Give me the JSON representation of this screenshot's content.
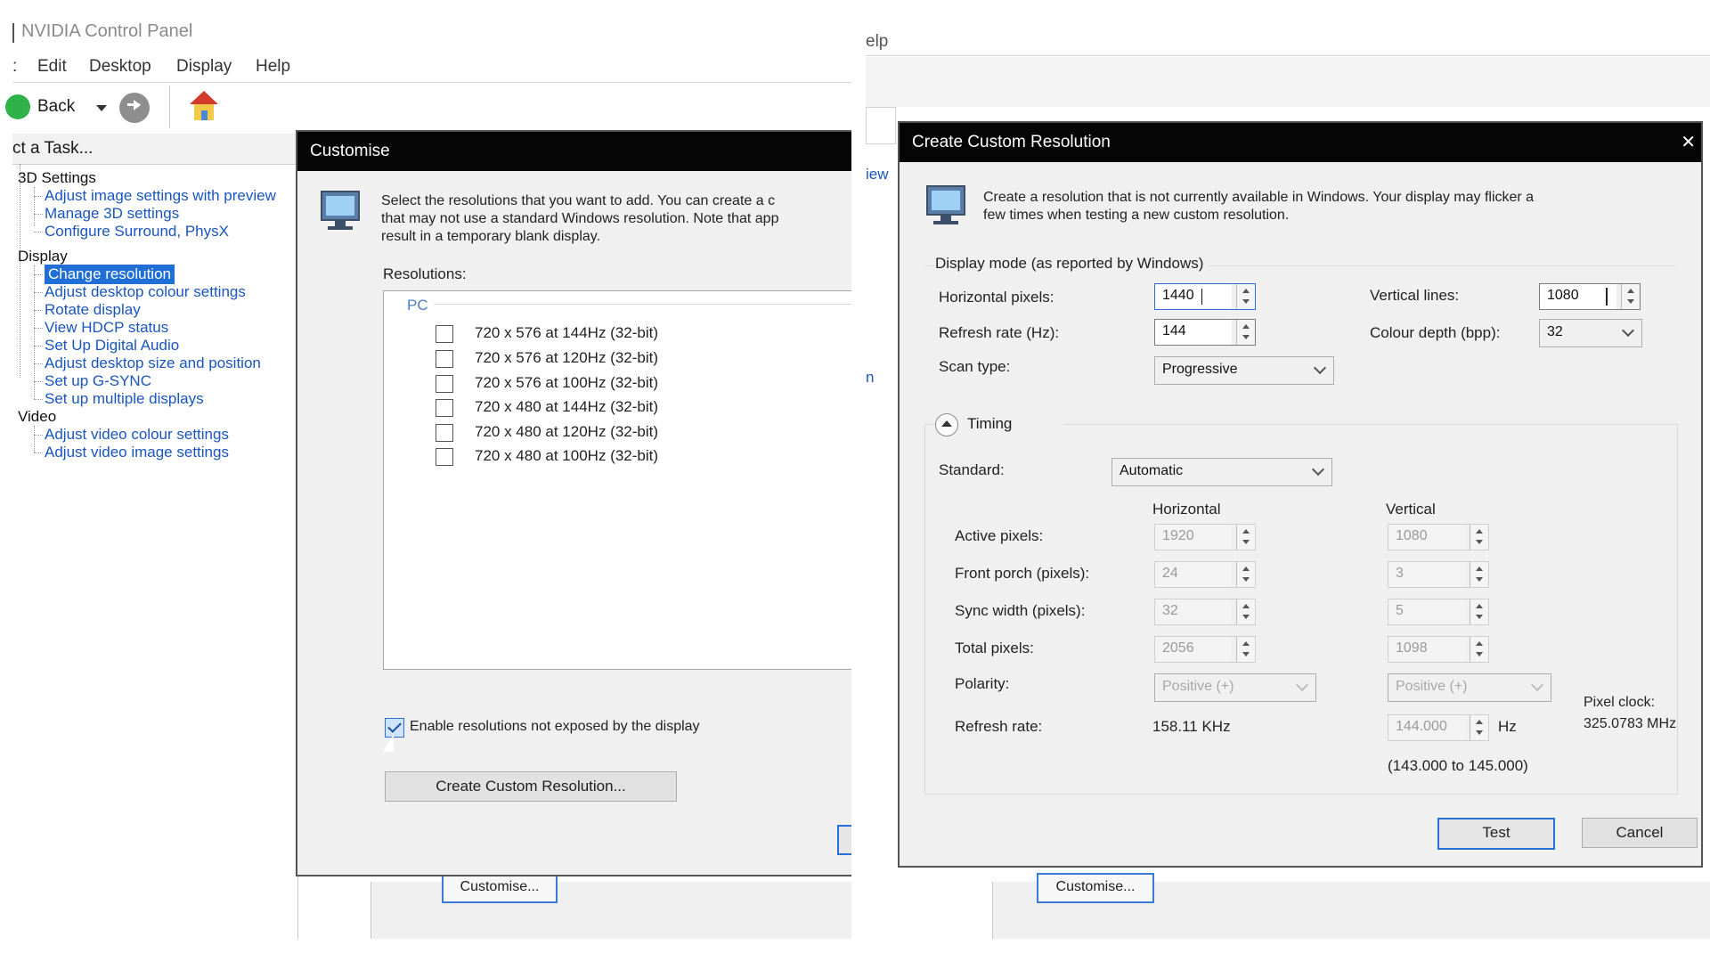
{
  "left": {
    "window_title": "NVIDIA Control Panel",
    "menu": [
      "Edit",
      "Desktop",
      "Display",
      "Help"
    ],
    "menu_fragment": ":",
    "toolbar": {
      "back_label": "Back"
    },
    "task_header": "ct a Task...",
    "tree": {
      "categories": [
        {
          "label": "3D Settings",
          "items": [
            "Adjust image settings with preview",
            "Manage 3D settings",
            "Configure Surround, PhysX"
          ]
        },
        {
          "label": "Display",
          "items": [
            "Change resolution",
            "Adjust desktop colour settings",
            "Rotate display",
            "View HDCP status",
            "Set Up Digital Audio",
            "Adjust desktop size and position",
            "Set up G-SYNC",
            "Set up multiple displays"
          ]
        },
        {
          "label": "Video",
          "items": [
            "Adjust video colour settings",
            "Adjust video image settings"
          ]
        }
      ],
      "selected_item": "Change resolution"
    },
    "background_customise_button": "Customise...",
    "customise_dialog": {
      "title": "Customise",
      "description_lines": [
        "Select the resolutions that you want to add. You can create a c",
        "that may not use a standard Windows resolution. Note that app",
        "result in a temporary blank display."
      ],
      "resolutions_label": "Resolutions:",
      "group_label": "PC",
      "resolutions": [
        "720 x 576 at 144Hz (32-bit)",
        "720 x 576 at 120Hz (32-bit)",
        "720 x 576 at 100Hz (32-bit)",
        "720 x 480 at 144Hz (32-bit)",
        "720 x 480 at 120Hz (32-bit)",
        "720 x 480 at 100Hz (32-bit)"
      ],
      "enable_checkbox_label": "Enable resolutions not exposed by the display",
      "enable_checked": true,
      "create_button": "Create Custom Resolution..."
    }
  },
  "right": {
    "menu_fragment": "elp",
    "side_fragments": [
      "iew",
      "n"
    ],
    "background_customise_button": "Customise...",
    "dialog": {
      "title": "Create Custom Resolution",
      "close_glyph": "✕",
      "description_lines": [
        "Create a resolution that is not currently available in Windows. Your display may flicker a",
        "few times when testing a new custom resolution."
      ],
      "display_mode_label": "Display mode (as reported by Windows)",
      "horizontal_pixels_label": "Horizontal pixels:",
      "horizontal_pixels_value": "1440",
      "vertical_lines_label": "Vertical lines:",
      "vertical_lines_value": "1080",
      "refresh_rate_label": "Refresh rate (Hz):",
      "refresh_rate_value": "144",
      "colour_depth_label": "Colour depth (bpp):",
      "colour_depth_value": "32",
      "scan_type_label": "Scan type:",
      "scan_type_value": "Progressive",
      "timing_label": "Timing",
      "standard_label": "Standard:",
      "standard_value": "Automatic",
      "horizontal_header": "Horizontal",
      "vertical_header": "Vertical",
      "rows": [
        {
          "label": "Active pixels:",
          "h": "1920",
          "v": "1080"
        },
        {
          "label": "Front porch (pixels):",
          "h": "24",
          "v": "3"
        },
        {
          "label": "Sync width (pixels):",
          "h": "32",
          "v": "5"
        },
        {
          "label": "Total pixels:",
          "h": "2056",
          "v": "1098"
        }
      ],
      "polarity_label": "Polarity:",
      "polarity_h": "Positive (+)",
      "polarity_v": "Positive (+)",
      "refresh_rate_row_label": "Refresh rate:",
      "h_refresh": "158.11 KHz",
      "v_refresh": "144.000",
      "hz_unit": "Hz",
      "refresh_range": "(143.000 to 145.000)",
      "pixel_clock_label": "Pixel clock:",
      "pixel_clock_value": "325.0783 MHz",
      "test_button": "Test",
      "cancel_button": "Cancel"
    }
  }
}
